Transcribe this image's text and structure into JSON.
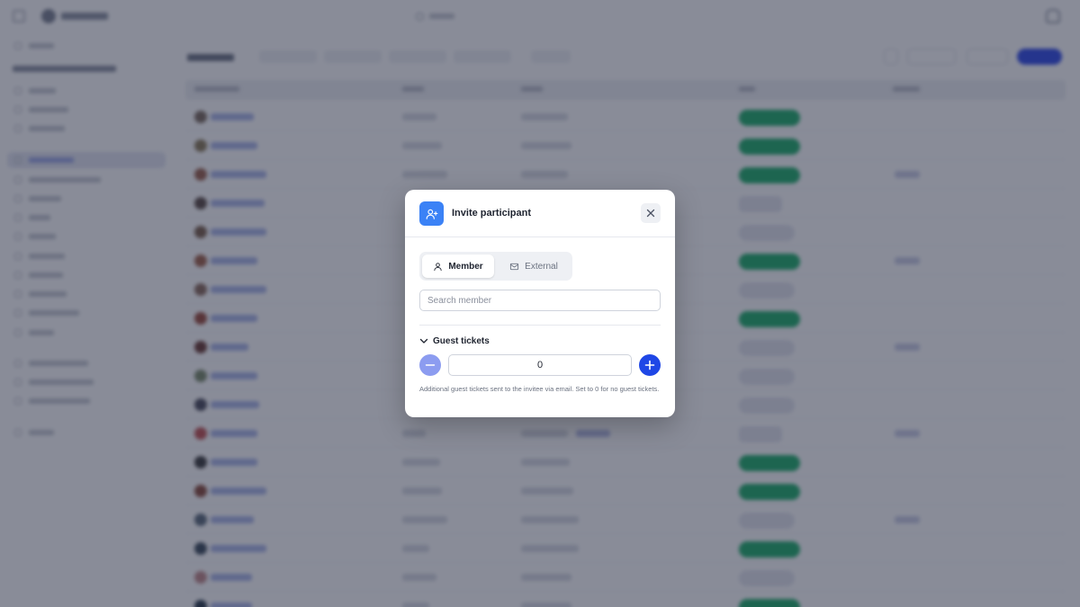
{
  "modal": {
    "title": "Invite participant",
    "tabs": [
      {
        "label": "Member",
        "selected": true
      },
      {
        "label": "External",
        "selected": false
      }
    ],
    "search_placeholder": "Search member",
    "guest_section_label": "Guest tickets",
    "guest_quantity": "0",
    "help_text": "Additional guest tickets sent to the invitee via email. Set to 0 for no guest tickets."
  },
  "colors": {
    "accent": "#1f47e6",
    "icon_badge": "#3b82f6",
    "minus_disabled": "#8c9cf0",
    "status_green": "#1fae6a",
    "overlay": "rgba(28, 35, 58, 0.52)"
  },
  "icons": {
    "header": "user-plus-icon",
    "close": "close-icon",
    "member_tab": "user-icon",
    "external_tab": "mail-icon",
    "collapse": "chevron-down-icon",
    "minus": "minus-icon",
    "plus": "plus-icon"
  }
}
